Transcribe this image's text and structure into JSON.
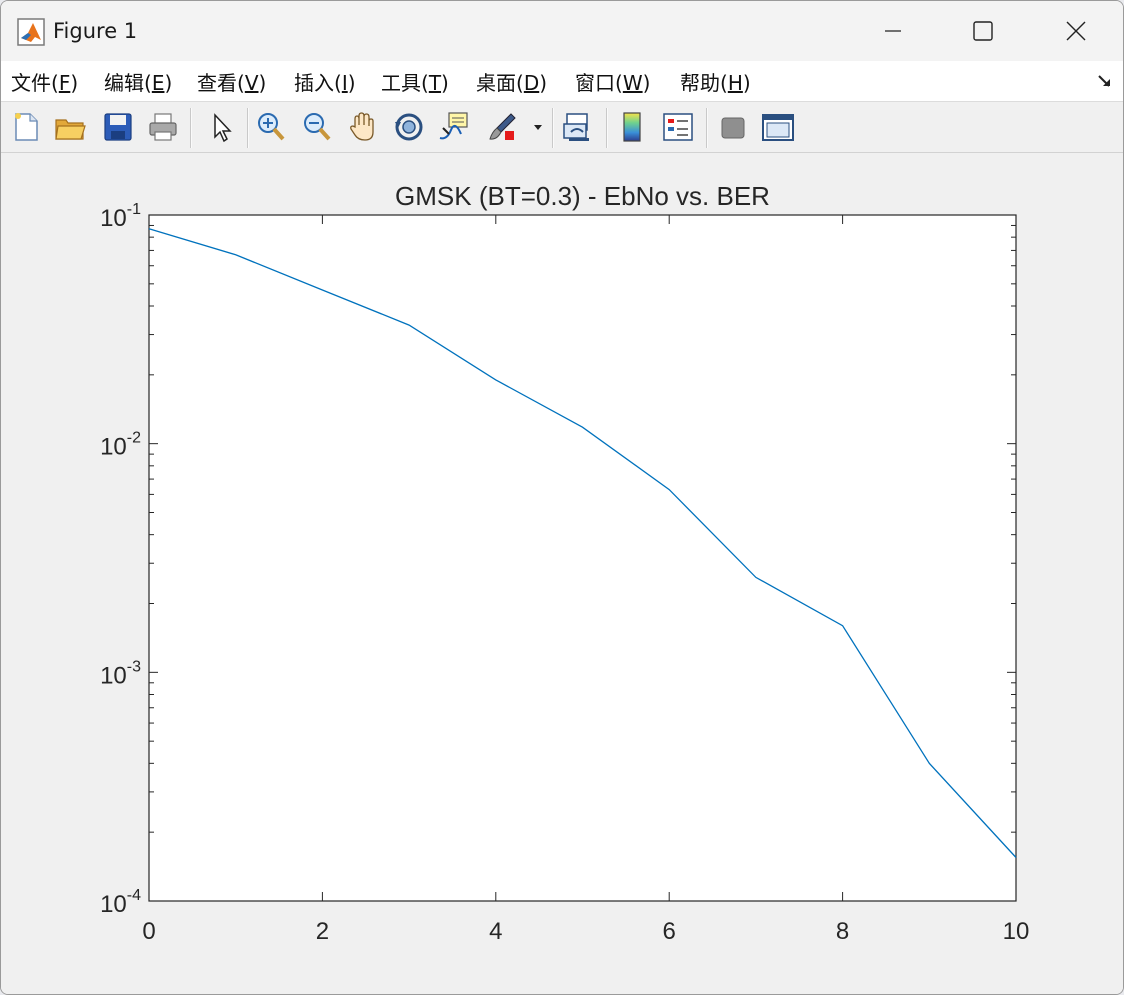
{
  "window": {
    "title": "Figure 1",
    "minimize_icon": "minimize-icon",
    "maximize_icon": "maximize-icon",
    "close_icon": "close-icon"
  },
  "menu": {
    "items": [
      {
        "label": "文件(F)",
        "mnemonic": "F"
      },
      {
        "label": "编辑(E)",
        "mnemonic": "E"
      },
      {
        "label": "查看(V)",
        "mnemonic": "V"
      },
      {
        "label": "插入(I)",
        "mnemonic": "I"
      },
      {
        "label": "工具(T)",
        "mnemonic": "T"
      },
      {
        "label": "桌面(D)",
        "mnemonic": "D"
      },
      {
        "label": "窗口(W)",
        "mnemonic": "W"
      },
      {
        "label": "帮助(H)",
        "mnemonic": "H"
      }
    ],
    "dock_icon": "dock-arrow-icon"
  },
  "toolbar": {
    "icons": [
      "new-figure-icon",
      "open-file-icon",
      "save-icon",
      "print-icon",
      "edit-plot-arrow-icon",
      "zoom-in-icon",
      "zoom-out-icon",
      "pan-hand-icon",
      "rotate-3d-icon",
      "data-cursor-icon",
      "brush-icon",
      "brush-dropdown-icon",
      "link-plot-icon",
      "colorbar-icon",
      "legend-icon",
      "hide-plot-tools-icon",
      "show-plot-tools-icon"
    ]
  },
  "chart_data": {
    "type": "line",
    "title": "GMSK (BT=0.3) - EbNo vs. BER",
    "xlabel": "",
    "ylabel": "",
    "x": [
      0,
      1,
      2,
      3,
      4,
      5,
      6,
      7,
      8,
      9,
      10
    ],
    "series": [
      {
        "values": [
          0.087,
          0.067,
          0.047,
          0.033,
          0.019,
          0.0118,
          0.0063,
          0.0026,
          0.0016,
          0.0004,
          0.000155
        ],
        "color": "#0072bd"
      }
    ],
    "xlim": [
      0,
      10
    ],
    "ylim": [
      0.0001,
      0.1
    ],
    "yscale": "log",
    "xticks": [
      "0",
      "2",
      "4",
      "6",
      "8",
      "10"
    ],
    "yticks": [
      {
        "base": "10",
        "exp": "-4"
      },
      {
        "base": "10",
        "exp": "-3"
      },
      {
        "base": "10",
        "exp": "-2"
      },
      {
        "base": "10",
        "exp": "-1"
      }
    ],
    "grid": false,
    "legend": "none"
  }
}
